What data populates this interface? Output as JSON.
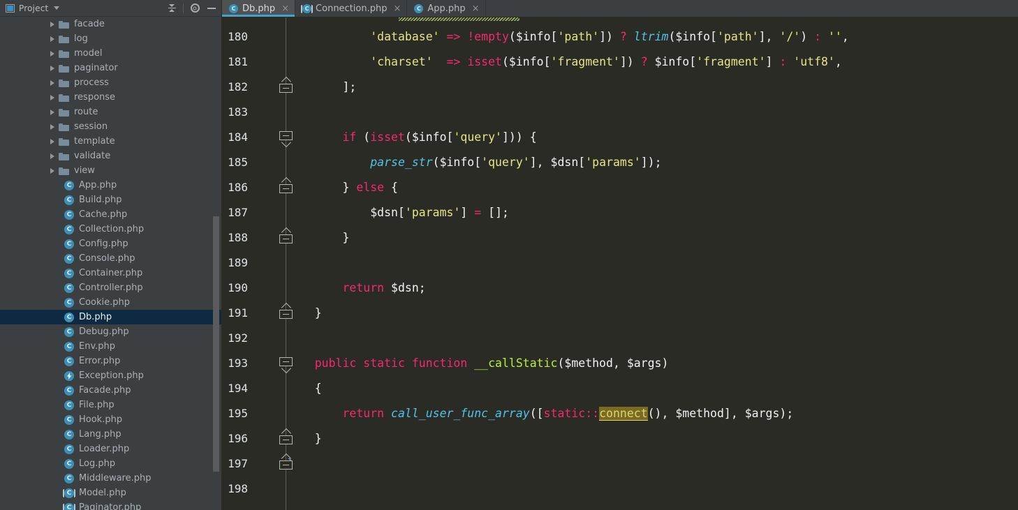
{
  "sidebar": {
    "panel_title": "Project",
    "icons": {
      "project": "project-icon",
      "dropdown": "chevron-down-icon",
      "collapse_all": "collapse-all-icon",
      "settings": "gear-icon",
      "minimize": "minimize-icon"
    },
    "tree": [
      {
        "label": "facade",
        "type": "folder",
        "indent": 1
      },
      {
        "label": "log",
        "type": "folder",
        "indent": 1
      },
      {
        "label": "model",
        "type": "folder",
        "indent": 1
      },
      {
        "label": "paginator",
        "type": "folder",
        "indent": 1
      },
      {
        "label": "process",
        "type": "folder",
        "indent": 1
      },
      {
        "label": "response",
        "type": "folder",
        "indent": 1
      },
      {
        "label": "route",
        "type": "folder",
        "indent": 1
      },
      {
        "label": "session",
        "type": "folder",
        "indent": 1
      },
      {
        "label": "template",
        "type": "folder",
        "indent": 1
      },
      {
        "label": "validate",
        "type": "folder",
        "indent": 1
      },
      {
        "label": "view",
        "type": "folder",
        "indent": 1
      },
      {
        "label": "App.php",
        "type": "class",
        "indent": 2
      },
      {
        "label": "Build.php",
        "type": "class",
        "indent": 2
      },
      {
        "label": "Cache.php",
        "type": "class",
        "indent": 2
      },
      {
        "label": "Collection.php",
        "type": "class",
        "indent": 2
      },
      {
        "label": "Config.php",
        "type": "class",
        "indent": 2
      },
      {
        "label": "Console.php",
        "type": "class",
        "indent": 2
      },
      {
        "label": "Container.php",
        "type": "class",
        "indent": 2
      },
      {
        "label": "Controller.php",
        "type": "class",
        "indent": 2
      },
      {
        "label": "Cookie.php",
        "type": "class",
        "indent": 2
      },
      {
        "label": "Db.php",
        "type": "class",
        "indent": 2,
        "selected": true
      },
      {
        "label": "Debug.php",
        "type": "class",
        "indent": 2
      },
      {
        "label": "Env.php",
        "type": "class",
        "indent": 2
      },
      {
        "label": "Error.php",
        "type": "class",
        "indent": 2
      },
      {
        "label": "Exception.php",
        "type": "exception",
        "indent": 2
      },
      {
        "label": "Facade.php",
        "type": "class",
        "indent": 2
      },
      {
        "label": "File.php",
        "type": "class",
        "indent": 2
      },
      {
        "label": "Hook.php",
        "type": "class",
        "indent": 2
      },
      {
        "label": "Lang.php",
        "type": "class",
        "indent": 2
      },
      {
        "label": "Loader.php",
        "type": "class",
        "indent": 2
      },
      {
        "label": "Log.php",
        "type": "class",
        "indent": 2
      },
      {
        "label": "Middleware.php",
        "type": "class",
        "indent": 2
      },
      {
        "label": "Model.php",
        "type": "abstract",
        "indent": 2
      },
      {
        "label": "Paginator.php",
        "type": "abstract",
        "indent": 2
      }
    ]
  },
  "editor": {
    "tabs": [
      {
        "label": "Db.php",
        "icon": "class-icon",
        "active": true,
        "close": "×"
      },
      {
        "label": "Connection.php",
        "icon": "abstract-icon",
        "active": false,
        "close": "×"
      },
      {
        "label": "App.php",
        "icon": "class-icon",
        "active": false,
        "close": "×"
      }
    ],
    "line_numbers": [
      "180",
      "181",
      "182",
      "183",
      "184",
      "185",
      "186",
      "187",
      "188",
      "189",
      "190",
      "191",
      "192",
      "193",
      "194",
      "195",
      "196",
      "197",
      "198"
    ],
    "lines": [
      {
        "number": "180",
        "tokens": [
          {
            "t": "            ",
            "c": "plain"
          },
          {
            "t": "'database'",
            "c": "str"
          },
          {
            "t": " ",
            "c": "plain"
          },
          {
            "t": "=>",
            "c": "op"
          },
          {
            "t": " ",
            "c": "plain"
          },
          {
            "t": "!empty",
            "c": "kw"
          },
          {
            "t": "(",
            "c": "plain"
          },
          {
            "t": "$info",
            "c": "var"
          },
          {
            "t": "[",
            "c": "plain"
          },
          {
            "t": "'path'",
            "c": "str"
          },
          {
            "t": "]) ",
            "c": "plain"
          },
          {
            "t": "?",
            "c": "op"
          },
          {
            "t": " ",
            "c": "plain"
          },
          {
            "t": "ltrim",
            "c": "fn"
          },
          {
            "t": "(",
            "c": "plain"
          },
          {
            "t": "$info",
            "c": "var"
          },
          {
            "t": "[",
            "c": "plain"
          },
          {
            "t": "'path'",
            "c": "str"
          },
          {
            "t": "], ",
            "c": "plain"
          },
          {
            "t": "'/'",
            "c": "str"
          },
          {
            "t": ") ",
            "c": "plain"
          },
          {
            "t": ":",
            "c": "op"
          },
          {
            "t": " ",
            "c": "plain"
          },
          {
            "t": "''",
            "c": "str"
          },
          {
            "t": ",",
            "c": "plain"
          }
        ]
      },
      {
        "number": "181",
        "tokens": [
          {
            "t": "            ",
            "c": "plain"
          },
          {
            "t": "'charset'",
            "c": "str"
          },
          {
            "t": "  ",
            "c": "plain"
          },
          {
            "t": "=>",
            "c": "op"
          },
          {
            "t": " ",
            "c": "plain"
          },
          {
            "t": "isset",
            "c": "kw"
          },
          {
            "t": "(",
            "c": "plain"
          },
          {
            "t": "$info",
            "c": "var"
          },
          {
            "t": "[",
            "c": "plain"
          },
          {
            "t": "'fragment'",
            "c": "str"
          },
          {
            "t": "]) ",
            "c": "plain"
          },
          {
            "t": "?",
            "c": "op"
          },
          {
            "t": " ",
            "c": "plain"
          },
          {
            "t": "$info",
            "c": "var"
          },
          {
            "t": "[",
            "c": "plain"
          },
          {
            "t": "'fragment'",
            "c": "str"
          },
          {
            "t": "] ",
            "c": "plain"
          },
          {
            "t": ":",
            "c": "op"
          },
          {
            "t": " ",
            "c": "plain"
          },
          {
            "t": "'utf8'",
            "c": "str"
          },
          {
            "t": ",",
            "c": "plain"
          }
        ]
      },
      {
        "number": "182",
        "tokens": [
          {
            "t": "        ];",
            "c": "plain"
          }
        ]
      },
      {
        "number": "183",
        "tokens": []
      },
      {
        "number": "184",
        "tokens": [
          {
            "t": "        ",
            "c": "plain"
          },
          {
            "t": "if",
            "c": "kw"
          },
          {
            "t": " (",
            "c": "plain"
          },
          {
            "t": "isset",
            "c": "kw"
          },
          {
            "t": "(",
            "c": "plain"
          },
          {
            "t": "$info",
            "c": "var"
          },
          {
            "t": "[",
            "c": "plain"
          },
          {
            "t": "'query'",
            "c": "str"
          },
          {
            "t": "])) {",
            "c": "plain"
          }
        ]
      },
      {
        "number": "185",
        "tokens": [
          {
            "t": "            ",
            "c": "plain"
          },
          {
            "t": "parse_str",
            "c": "fn"
          },
          {
            "t": "(",
            "c": "plain"
          },
          {
            "t": "$info",
            "c": "var"
          },
          {
            "t": "[",
            "c": "plain"
          },
          {
            "t": "'query'",
            "c": "str"
          },
          {
            "t": "], ",
            "c": "plain"
          },
          {
            "t": "$dsn",
            "c": "var"
          },
          {
            "t": "[",
            "c": "plain"
          },
          {
            "t": "'params'",
            "c": "str"
          },
          {
            "t": "]);",
            "c": "plain"
          }
        ]
      },
      {
        "number": "186",
        "tokens": [
          {
            "t": "        } ",
            "c": "plain"
          },
          {
            "t": "else",
            "c": "kw"
          },
          {
            "t": " {",
            "c": "plain"
          }
        ]
      },
      {
        "number": "187",
        "tokens": [
          {
            "t": "            ",
            "c": "plain"
          },
          {
            "t": "$dsn",
            "c": "var"
          },
          {
            "t": "[",
            "c": "plain"
          },
          {
            "t": "'params'",
            "c": "str"
          },
          {
            "t": "] ",
            "c": "plain"
          },
          {
            "t": "=",
            "c": "op"
          },
          {
            "t": " [];",
            "c": "plain"
          }
        ]
      },
      {
        "number": "188",
        "tokens": [
          {
            "t": "        }",
            "c": "plain"
          }
        ]
      },
      {
        "number": "189",
        "tokens": []
      },
      {
        "number": "190",
        "tokens": [
          {
            "t": "        ",
            "c": "plain"
          },
          {
            "t": "return",
            "c": "kw"
          },
          {
            "t": " ",
            "c": "plain"
          },
          {
            "t": "$dsn",
            "c": "var"
          },
          {
            "t": ";",
            "c": "plain"
          }
        ]
      },
      {
        "number": "191",
        "tokens": [
          {
            "t": "    }",
            "c": "plain"
          }
        ]
      },
      {
        "number": "192",
        "tokens": []
      },
      {
        "number": "193",
        "tokens": [
          {
            "t": "    ",
            "c": "plain"
          },
          {
            "t": "public static function",
            "c": "kw"
          },
          {
            "t": " ",
            "c": "plain"
          },
          {
            "t": "__callStatic",
            "c": "meth"
          },
          {
            "t": "(",
            "c": "plain"
          },
          {
            "t": "$method",
            "c": "var"
          },
          {
            "t": ", ",
            "c": "plain"
          },
          {
            "t": "$args",
            "c": "var"
          },
          {
            "t": ")",
            "c": "plain"
          }
        ]
      },
      {
        "number": "194",
        "tokens": [
          {
            "t": "    {",
            "c": "plain"
          }
        ]
      },
      {
        "number": "195",
        "tokens": [
          {
            "t": "        ",
            "c": "plain"
          },
          {
            "t": "return",
            "c": "kw"
          },
          {
            "t": " ",
            "c": "plain"
          },
          {
            "t": "call_user_func_array",
            "c": "fn"
          },
          {
            "t": "([",
            "c": "plain"
          },
          {
            "t": "static::",
            "c": "kw"
          },
          {
            "t": "connect",
            "c": "hl"
          },
          {
            "t": "(), ",
            "c": "plain"
          },
          {
            "t": "$method",
            "c": "var"
          },
          {
            "t": "], ",
            "c": "plain"
          },
          {
            "t": "$args",
            "c": "var"
          },
          {
            "t": ");",
            "c": "plain"
          }
        ]
      },
      {
        "number": "196",
        "tokens": [
          {
            "t": "    }",
            "c": "plain"
          }
        ]
      },
      {
        "number": "197",
        "tokens": [
          {
            "t": "}",
            "c": "brace"
          }
        ]
      },
      {
        "number": "198",
        "tokens": []
      }
    ],
    "fold_markers": [
      {
        "line": "182",
        "dir": "up"
      },
      {
        "line": "184",
        "dir": "down"
      },
      {
        "line": "186",
        "dir": "up"
      },
      {
        "line": "188",
        "dir": "up"
      },
      {
        "line": "191",
        "dir": "up"
      },
      {
        "line": "193",
        "dir": "down"
      },
      {
        "line": "196",
        "dir": "up"
      },
      {
        "line": "197",
        "dir": "up"
      }
    ],
    "colors": {
      "background": "#2b2b26",
      "string": "#e4e487",
      "keyword": "#f5296e",
      "function": "#4fc3e8",
      "method": "#b6ec42",
      "variable": "#f2f2f2",
      "highlight_bg": "#7a6a24",
      "tab_accent": "#46a0c8",
      "selection_bg": "#0d2a42",
      "sidebar_bg": "#3c3f41"
    }
  }
}
